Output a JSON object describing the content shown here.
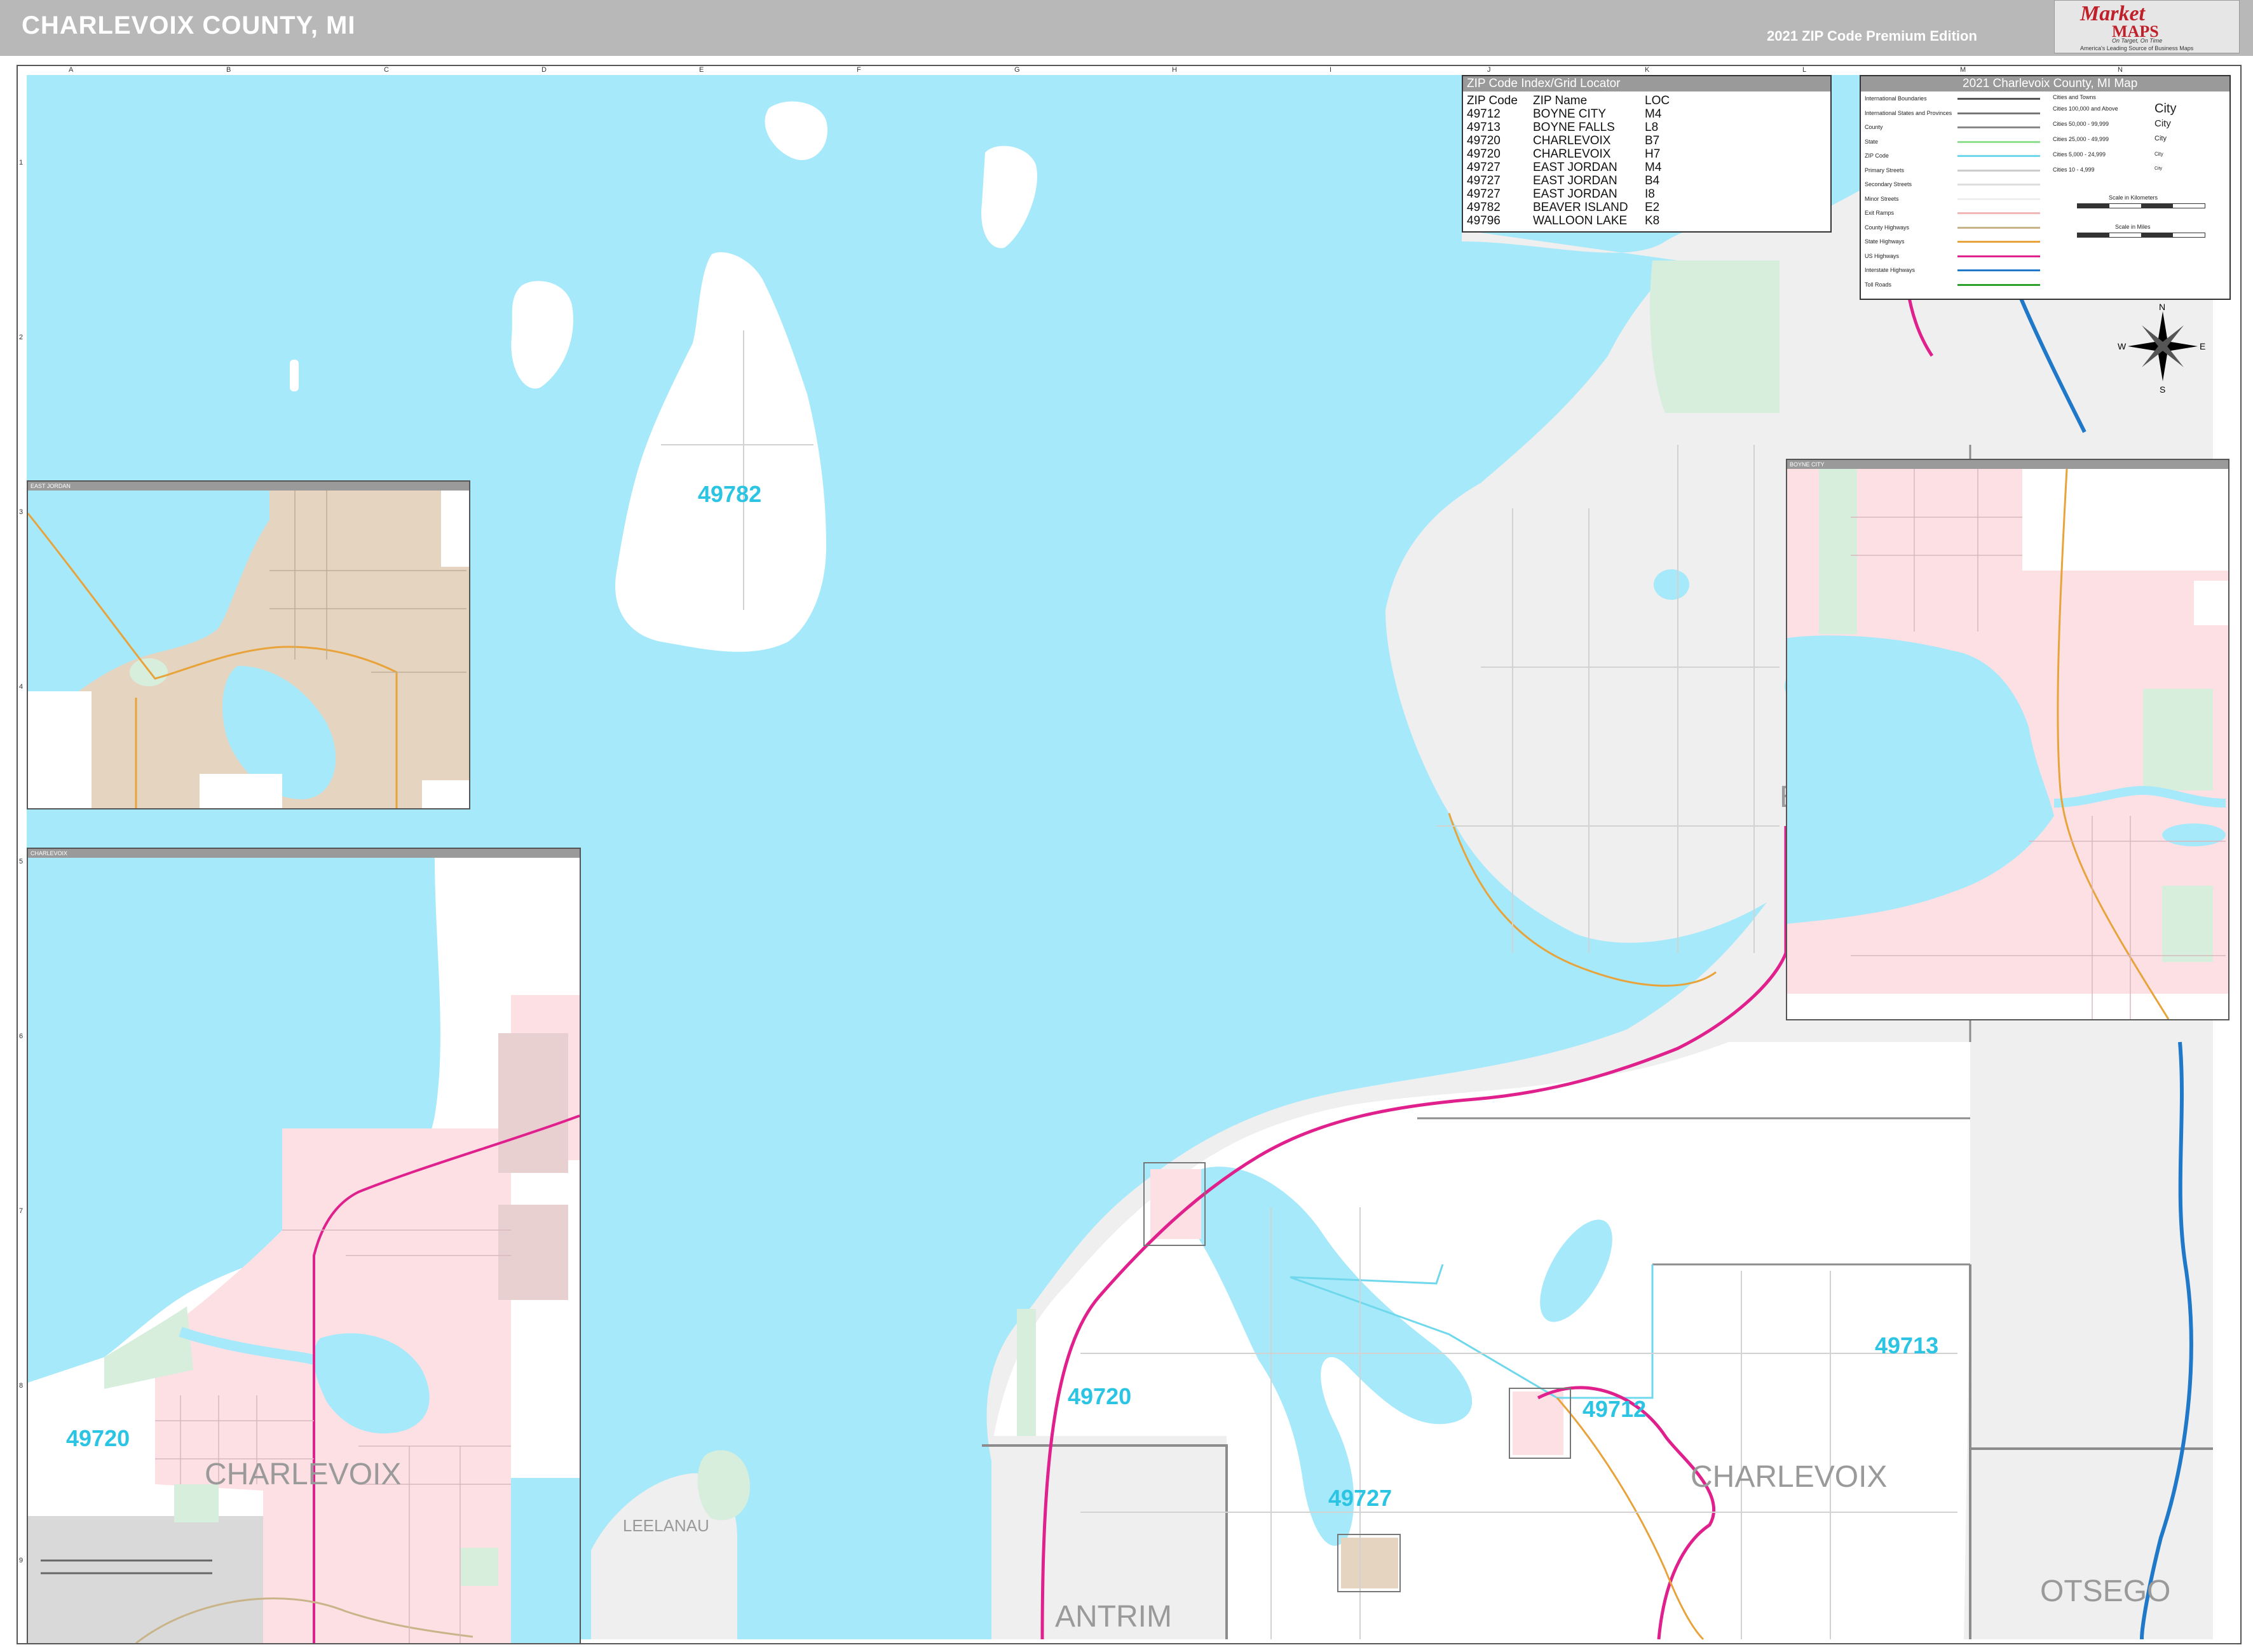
{
  "header": {
    "title": "CHARLEVOIX COUNTY, MI",
    "edition": "2021 ZIP Code Premium Edition"
  },
  "logo": {
    "word1": "Market",
    "word2": "MAPS",
    "tagline": "On Target, On Time",
    "subtitle": "America's Leading Source of Business Maps"
  },
  "grid": {
    "columns": [
      "A",
      "B",
      "C",
      "D",
      "E",
      "F",
      "G",
      "H",
      "I",
      "J",
      "K",
      "L",
      "M",
      "N"
    ],
    "rows": [
      "1",
      "2",
      "3",
      "4",
      "5",
      "6",
      "7",
      "8",
      "9"
    ]
  },
  "zip_index": {
    "title": "ZIP Code Index/Grid Locator",
    "headers": [
      "ZIP Code",
      "ZIP Name",
      "LOC"
    ],
    "rows": [
      [
        "49712",
        "BOYNE CITY",
        "M4"
      ],
      [
        "49713",
        "BOYNE FALLS",
        "L8"
      ],
      [
        "49720",
        "CHARLEVOIX",
        "B7"
      ],
      [
        "49720",
        "CHARLEVOIX",
        "H7"
      ],
      [
        "49727",
        "EAST JORDAN",
        "M4"
      ],
      [
        "49727",
        "EAST JORDAN",
        "B4"
      ],
      [
        "49727",
        "EAST JORDAN",
        "I8"
      ],
      [
        "49782",
        "BEAVER ISLAND",
        "E2"
      ],
      [
        "49796",
        "WALLOON LAKE",
        "K8"
      ]
    ]
  },
  "legend": {
    "title": "2021 Charlevoix County, MI Map",
    "items": [
      {
        "label": "International Boundaries",
        "color": "#555555"
      },
      {
        "label": "International States and Provinces",
        "color": "#777777"
      },
      {
        "label": "County",
        "color": "#888888"
      },
      {
        "label": "State",
        "color": "#8ee08e"
      },
      {
        "label": "ZIP Code",
        "color": "#6fd8ec"
      },
      {
        "label": "Primary Streets",
        "color": "#cccccc"
      },
      {
        "label": "Secondary Streets",
        "color": "#dddddd"
      },
      {
        "label": "Minor Streets",
        "color": "#eeeeee"
      },
      {
        "label": "Exit Ramps",
        "color": "#f2b8b8"
      },
      {
        "label": "County Highways",
        "color": "#c9b48a"
      },
      {
        "label": "State Highways",
        "color": "#e8a33b"
      },
      {
        "label": "US Highways",
        "color": "#e0208c"
      },
      {
        "label": "Interstate Highways",
        "color": "#1f78c8"
      },
      {
        "label": "Toll Roads",
        "color": "#2aa02a"
      }
    ],
    "cities_title": "Cities and Towns",
    "cities": [
      {
        "label": "Cities 100,000 and Above",
        "sample": "City"
      },
      {
        "label": "Cities 50,000 - 99,999",
        "sample": "City"
      },
      {
        "label": "Cities 25,000 - 49,999",
        "sample": "City"
      },
      {
        "label": "Cities 5,000 - 24,999",
        "sample": "City"
      },
      {
        "label": "Cities 10 - 4,999",
        "sample": "City"
      }
    ],
    "scale_km": "Scale in Kilometers",
    "scale_mi": "Scale in Miles"
  },
  "compass": {
    "n": "N",
    "s": "S",
    "e": "E",
    "w": "W"
  },
  "zip_labels": [
    "49782",
    "49720",
    "49727",
    "49712",
    "49713",
    "49720"
  ],
  "county_labels": [
    "CHARLEVOIX",
    "ANTRIM",
    "OTSEGO",
    "LEELANAU",
    "CHARLEVOIX",
    "E"
  ],
  "insets": {
    "east_jordan": "EAST JORDAN",
    "boyne_city": "BOYNE CITY",
    "charlevoix": "CHARLEVOIX"
  },
  "colors": {
    "water": "#a6e9fa",
    "land": "#ffffff",
    "park": "#d7eedc",
    "urban": "#fde0e4",
    "inset_land": "#e4d4c0",
    "other_county": "#efefef",
    "zip_text": "#2bc4e3",
    "header": "#b8b8b8"
  }
}
